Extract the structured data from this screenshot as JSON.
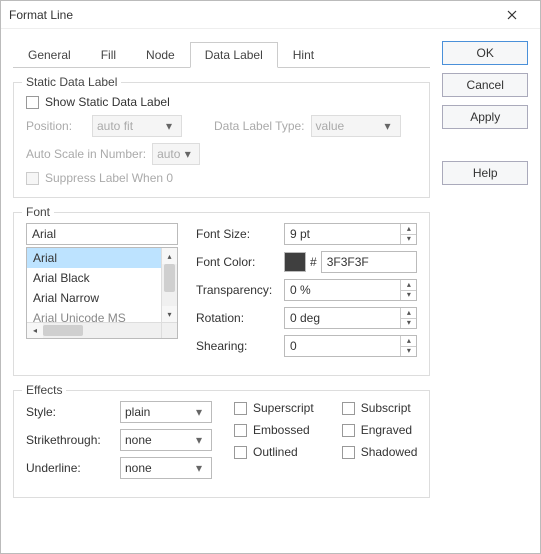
{
  "window": {
    "title": "Format Line"
  },
  "buttons": {
    "ok": "OK",
    "cancel": "Cancel",
    "apply": "Apply",
    "help": "Help"
  },
  "tabs": [
    "General",
    "Fill",
    "Node",
    "Data Label",
    "Hint"
  ],
  "active_tab_index": 3,
  "static_group": {
    "legend": "Static Data Label",
    "show_label": "Show Static Data Label",
    "position_lab": "Position:",
    "position_val": "auto fit",
    "type_lab": "Data Label Type:",
    "type_val": "value",
    "autoscale_lab": "Auto Scale in Number:",
    "autoscale_val": "auto",
    "suppress_label": "Suppress Label When 0"
  },
  "font_group": {
    "legend": "Font",
    "family_input": "Arial",
    "family_list": [
      "Arial",
      "Arial Black",
      "Arial Narrow",
      "Arial Unicode MS"
    ],
    "selected_index": 0,
    "size_lab": "Font Size:",
    "size_val": "9 pt",
    "color_lab": "Font Color:",
    "color_hash": "#",
    "color_hex": "3F3F3F",
    "transp_lab": "Transparency:",
    "transp_val": "0 %",
    "rot_lab": "Rotation:",
    "rot_val": "0 deg",
    "shear_lab": "Shearing:",
    "shear_val": "0"
  },
  "effects_group": {
    "legend": "Effects",
    "style_lab": "Style:",
    "style_val": "plain",
    "strike_lab": "Strikethrough:",
    "strike_val": "none",
    "under_lab": "Underline:",
    "under_val": "none",
    "checks": {
      "superscript": "Superscript",
      "subscript": "Subscript",
      "embossed": "Embossed",
      "engraved": "Engraved",
      "outlined": "Outlined",
      "shadowed": "Shadowed"
    }
  }
}
